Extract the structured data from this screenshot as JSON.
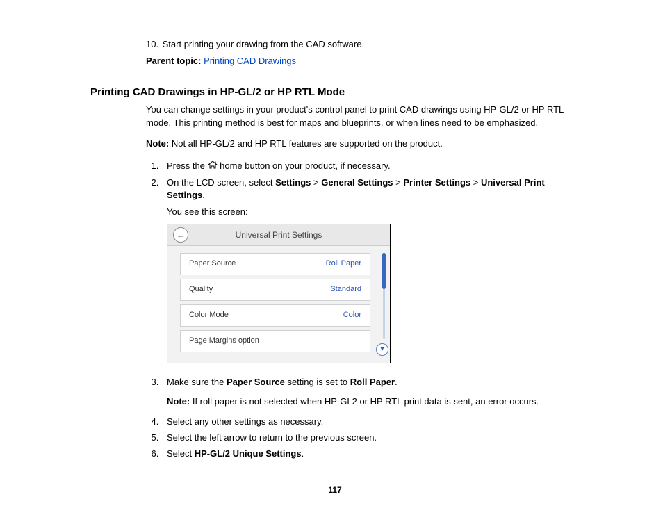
{
  "preStep": {
    "num": "10.",
    "text": "Start printing your drawing from the CAD software."
  },
  "parentTopic": {
    "label": "Parent topic:",
    "link": "Printing CAD Drawings"
  },
  "heading": "Printing CAD Drawings in HP-GL/2 or HP RTL Mode",
  "intro": "You can change settings in your product's control panel to print CAD drawings using HP-GL/2 or HP RTL mode. This printing method is best for maps and blueprints, or when lines need to be emphasized.",
  "note1": {
    "label": "Note:",
    "text": " Not all HP-GL/2 and HP RTL features are supported on the product."
  },
  "step1": {
    "pre": "Press the ",
    "post": " home button on your product, if necessary."
  },
  "step2": {
    "pre": "On the LCD screen, select ",
    "b1": "Settings",
    "sep": " > ",
    "b2": "General Settings",
    "b3": "Printer Settings",
    "b4": "Universal Print Settings",
    "end": ".",
    "sub": "You see this screen:"
  },
  "panel": {
    "title": "Universal Print Settings",
    "rows": [
      {
        "label": "Paper Source",
        "value": "Roll Paper"
      },
      {
        "label": "Quality",
        "value": "Standard"
      },
      {
        "label": "Color Mode",
        "value": "Color"
      },
      {
        "label": "Page Margins option",
        "value": ""
      }
    ]
  },
  "step3": {
    "t1": "Make sure the ",
    "b1": "Paper Source",
    "t2": " setting is set to ",
    "b2": "Roll Paper",
    "t3": ".",
    "noteLabel": "Note:",
    "noteText": " If roll paper is not selected when HP-GL2 or HP RTL print data is sent, an error occurs."
  },
  "step4": "Select any other settings as necessary.",
  "step5": "Select the left arrow to return to the previous screen.",
  "step6": {
    "t1": "Select ",
    "b1": "HP-GL/2 Unique Settings",
    "t2": "."
  },
  "pageNum": "117"
}
